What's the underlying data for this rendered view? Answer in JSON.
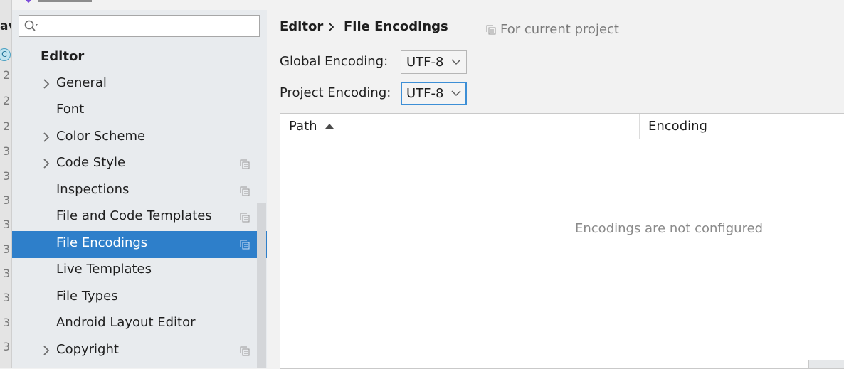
{
  "gutter": {
    "truncated_label": "av",
    "c_badge": "C",
    "line_numbers": [
      "2",
      "2",
      "2",
      "3",
      "3",
      "3",
      "3",
      "3",
      "3",
      "3",
      "3",
      "3",
      "3"
    ]
  },
  "sidebar": {
    "search": {
      "value": "",
      "placeholder": ""
    },
    "section_title": "Editor",
    "items": [
      {
        "label": "General",
        "expandable": true,
        "project_scope": false
      },
      {
        "label": "Font",
        "expandable": false,
        "project_scope": false
      },
      {
        "label": "Color Scheme",
        "expandable": true,
        "project_scope": false
      },
      {
        "label": "Code Style",
        "expandable": true,
        "project_scope": true
      },
      {
        "label": "Inspections",
        "expandable": false,
        "project_scope": true
      },
      {
        "label": "File and Code Templates",
        "expandable": false,
        "project_scope": true
      },
      {
        "label": "File Encodings",
        "expandable": false,
        "project_scope": true,
        "selected": true
      },
      {
        "label": "Live Templates",
        "expandable": false,
        "project_scope": false
      },
      {
        "label": "File Types",
        "expandable": false,
        "project_scope": false
      },
      {
        "label": "Android Layout Editor",
        "expandable": false,
        "project_scope": false
      },
      {
        "label": "Copyright",
        "expandable": true,
        "project_scope": true
      }
    ]
  },
  "main": {
    "breadcrumb": [
      "Editor",
      "File Encodings"
    ],
    "scope_note": "For current project",
    "global_encoding": {
      "label": "Global Encoding:",
      "value": "UTF-8"
    },
    "project_encoding": {
      "label": "Project Encoding:",
      "value": "UTF-8"
    },
    "table": {
      "columns": [
        "Path",
        "Encoding"
      ],
      "sort_column": "Path",
      "sort_direction": "ascending",
      "empty_text": "Encodings are not configured",
      "rows": []
    }
  },
  "colors": {
    "selection": "#2e7fca",
    "focus_border": "#3d8fd6",
    "sidebar_bg": "#e8ebee",
    "panel_bg": "#f2f2f2"
  }
}
